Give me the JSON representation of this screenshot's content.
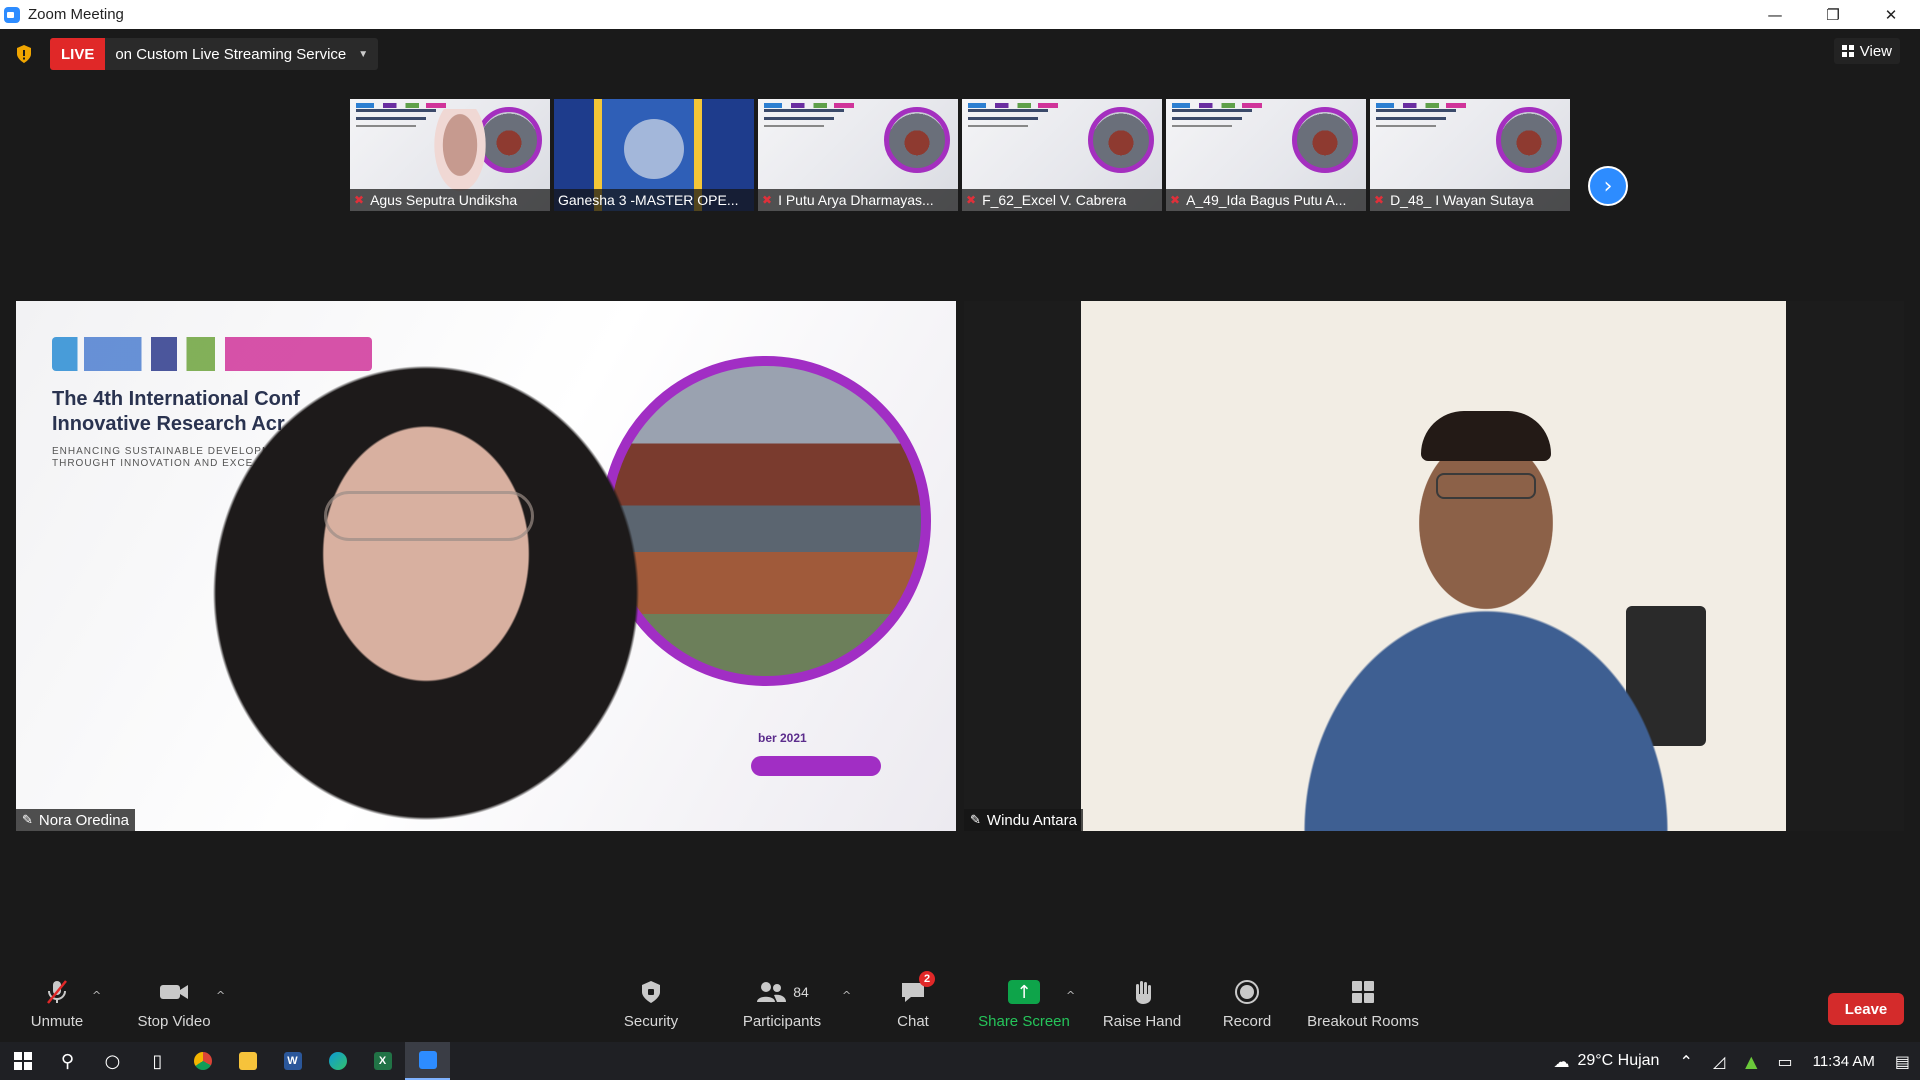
{
  "window": {
    "title": "Zoom Meeting",
    "minimize": "—",
    "restore": "❐",
    "close": "✕"
  },
  "top_bar": {
    "live_badge": "LIVE",
    "live_destination": "on Custom Live Streaming Service",
    "view_label": "View"
  },
  "thumbnails": [
    {
      "name": "Agus Seputra Undiksha",
      "muted": true,
      "kind": "person"
    },
    {
      "name": "Ganesha 3 -MASTER OPE...",
      "muted": false,
      "kind": "flag"
    },
    {
      "name": "I Putu Arya Dharmayas...",
      "muted": true,
      "kind": "slide"
    },
    {
      "name": "F_62_Excel V. Cabrera",
      "muted": true,
      "kind": "slide"
    },
    {
      "name": "A_49_Ida Bagus Putu A...",
      "muted": true,
      "kind": "slide"
    },
    {
      "name": "D_48_ I Wayan Sutaya",
      "muted": true,
      "kind": "slide"
    }
  ],
  "main_videos": {
    "left": {
      "name": "Nora Oredina",
      "slide_title_line1": "The 4th International Conf",
      "slide_title_line2": "Innovative Research Acr",
      "slide_sub_line1": "ENHANCING SUSTAINABLE DEVELOPM",
      "slide_sub_line2": "THROUGHT INNOVATION AND EXCE",
      "slide_date": "ber 2021"
    },
    "right": {
      "name": "Windu Antara"
    }
  },
  "toolbar": {
    "unmute": "Unmute",
    "stop_video": "Stop Video",
    "security": "Security",
    "participants": "Participants",
    "participants_count": "84",
    "chat": "Chat",
    "chat_badge": "2",
    "share_screen": "Share Screen",
    "raise_hand": "Raise Hand",
    "record": "Record",
    "breakout_rooms": "Breakout Rooms",
    "leave": "Leave"
  },
  "taskbar": {
    "weather": "29°C  Hujan",
    "time": "11:34 AM"
  },
  "colors": {
    "accent": "#2d8cff",
    "live": "#e02828",
    "share_green": "#0ea44a",
    "leave_red": "#d42b2b"
  }
}
